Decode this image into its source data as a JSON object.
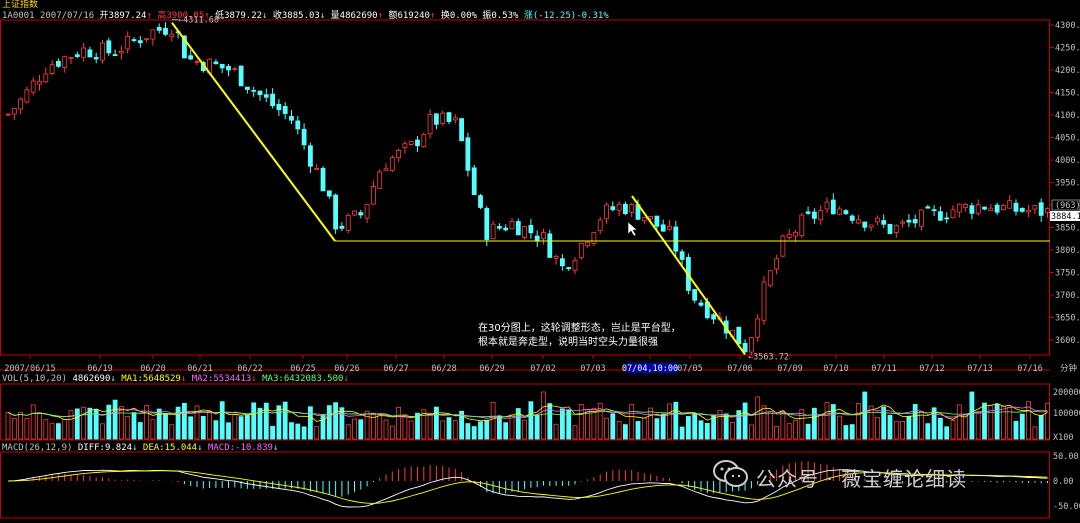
{
  "header": {
    "title": "上证指数",
    "code": "1A0001",
    "date": "2007/07/16",
    "open": "开3897.24",
    "high": "高3900.05",
    "low": "低3879.22",
    "close": "收3885.03",
    "volume": "量4862690",
    "amount": "额619240",
    "change_pct": "换0.00%",
    "amplitude": "振0.53%",
    "rise": "涨(-12.25)-0.31%"
  },
  "price_axis": {
    "ticks": [
      "4300.00",
      "4250.00",
      "4200.00",
      "4150.00",
      "4100.00",
      "4050.00",
      "4000.00",
      "3950.00",
      "3900.00",
      "3850.00",
      "3800.00",
      "3750.00",
      "3700.00",
      "3650.00",
      "3600.00"
    ],
    "current_label": "3884.16",
    "range_label": "(963)"
  },
  "markers": {
    "high_label": "4311.68",
    "low_label": "3563.72"
  },
  "date_axis": [
    "2007/06/15",
    "06/19",
    "06/20",
    "06/21",
    "06/22",
    "06/25",
    "06/26",
    "06/27",
    "06/28",
    "06/29",
    "07/02",
    "07/03",
    "07/04,10:00",
    "07/05",
    "07/06",
    "07/09",
    "07/10",
    "07/11",
    "07/12",
    "07/13",
    "07/16"
  ],
  "date_axis_end": "分钟",
  "volume": {
    "label": "VOL(5,10,20)",
    "value": "4862690",
    "ma1": "MA1:5648529",
    "ma2": "MA2:5534413",
    "ma3": "MA3:6432083.500",
    "ticks": [
      "200000",
      "100000",
      "X100"
    ]
  },
  "macd": {
    "label": "MACD(26,12,9)",
    "diff": "DIFF:9.824",
    "dea": "DEA:15.044",
    "macd": "MACD:-10.839",
    "ticks": [
      "50.00",
      "0.00",
      "-50.00"
    ]
  },
  "annotation": {
    "line1": "在30分图上，这轮调整形态，岂止是平台型，",
    "line2": "根本就是奔走型，说明当时空头力量很强"
  },
  "watermark": "公众号 · 薇宝缠论细读",
  "colors": {
    "up": "#ff3b3b",
    "down": "#54ffff",
    "trend": "#ffff00",
    "axis": "#c00000"
  },
  "chart_data": {
    "type": "candlestick",
    "price_range": [
      3563.72,
      4311.68
    ],
    "high": 4311.68,
    "low": 3563.72,
    "support_level": 3820,
    "last_close": 3885.03
  }
}
